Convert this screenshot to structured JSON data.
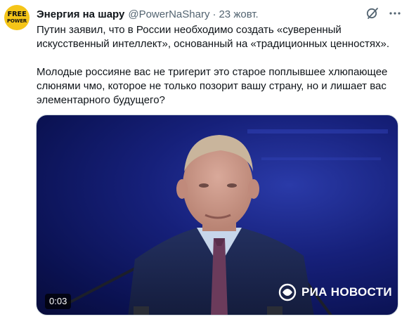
{
  "author": {
    "avatar_text_top": "FREE",
    "avatar_text_bottom": "POWER",
    "name": "Энергия на шару",
    "handle": "@PowerNaShary",
    "separator": "·",
    "date": "23 жовт."
  },
  "tweet": {
    "paragraph1_line1": "Путин заявил, что в России необходимо создать «суверенный",
    "paragraph1_line2": "искусственный интеллект», основанный на «традиционных ценностях».",
    "paragraph2_line1": "Молодые россияне вас не тригерит это старое поплывшее хлюпающее",
    "paragraph2_line2": "слюнями чмо, которое не только позорит вашу страну, но и лишает вас",
    "paragraph2_line3": "элементарного будущего?"
  },
  "video": {
    "watermark": "РИА НОВОСТИ",
    "time": "0:03"
  },
  "icons": {
    "grok": "grok-icon",
    "more": "more-icon"
  },
  "colors": {
    "text": "#0f1419",
    "secondary": "#536471",
    "avatar": "#f5c518",
    "video_bg": "#16207a"
  }
}
